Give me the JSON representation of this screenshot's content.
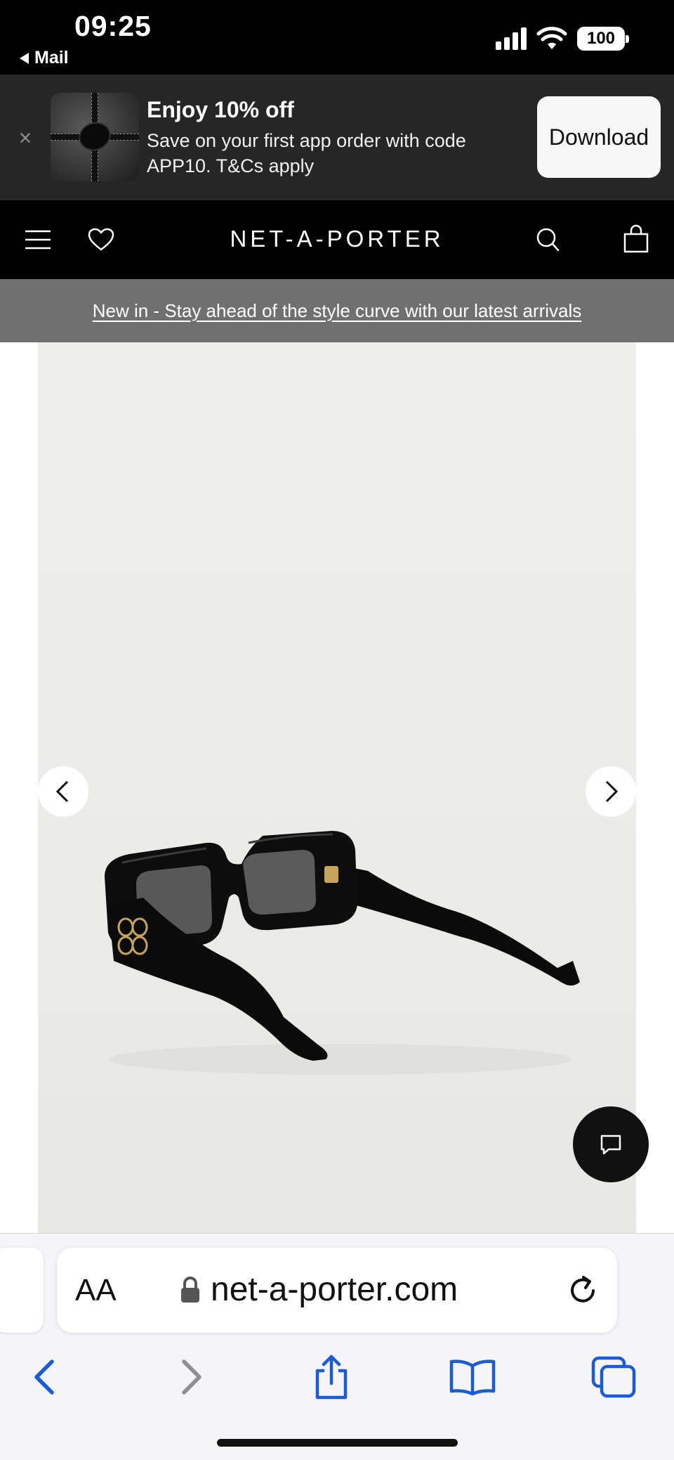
{
  "status_bar": {
    "time": "09:25",
    "back_app": "Mail",
    "battery": "100"
  },
  "app_banner": {
    "title": "Enjoy 10% off",
    "text": "Save on your first app order with code APP10. T&Cs apply",
    "download_label": "Download"
  },
  "header": {
    "logo": "NET-A-PORTER"
  },
  "promo": {
    "text": "New in - Stay ahead of the style curve with our latest arrivals"
  },
  "gallery": {
    "product_image_alt": "Black rectangular sunglasses with gold anagram logo"
  },
  "browser": {
    "text_size_label": "AA",
    "url": "net-a-porter.com"
  },
  "colors": {
    "accent_blue": "#1a5bd6",
    "header_bg": "#000000",
    "banner_bg": "#262626",
    "promo_bg": "#707070"
  }
}
